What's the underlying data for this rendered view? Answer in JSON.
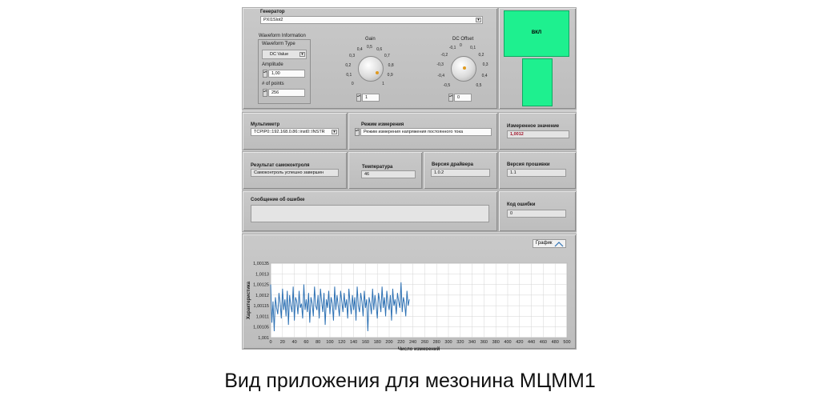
{
  "generator": {
    "title": "Генератор",
    "resource": "PXI1Slot2",
    "waveform_info_title": "Waveform Information",
    "waveform_type_label": "Waveform Type",
    "waveform_type_value": "DC Value",
    "amplitude_label": "Amplitude",
    "amplitude_value": "1,00",
    "points_label": "# of points",
    "points_value": "256",
    "gain": {
      "label": "Gain",
      "ticks": [
        "0",
        "0,1",
        "0,2",
        "0,3",
        "0,4",
        "0,5",
        "0,6",
        "0,7",
        "0,8",
        "0,9",
        "1"
      ],
      "value_text": "1"
    },
    "dc_offset": {
      "label": "DC Offset",
      "ticks": [
        "-0,5",
        "-0,4",
        "-0,3",
        "-0,2",
        "-0,1",
        "0",
        "0,1",
        "0,2",
        "0,3",
        "0,4",
        "0,5"
      ],
      "value_text": "0"
    }
  },
  "power": {
    "label": "ВКЛ",
    "color": "#1ef08f"
  },
  "multimeter": {
    "title": "Мультиметр",
    "resource": "TCPIP0::192.168.0.86::inst0::INSTR",
    "mode_label": "Режим измерения",
    "mode_value": "Режим измерения напряжения постоянного тока",
    "measured_label": "Измеренное значение",
    "measured_value": "1,0012"
  },
  "status": {
    "selftest_label": "Результат самоконтроля",
    "selftest_value": "Самоконтроль успешно завершен",
    "temp_label": "Температура",
    "temp_value": "46",
    "driver_label": "Версия драйвера",
    "driver_value": "1.0.2",
    "firmware_label": "Версия прошивки",
    "firmware_value": "1.1",
    "error_msg_label": "Сообщение об ошибке",
    "error_msg_value": "",
    "error_code_label": "Код ошибки",
    "error_code_value": "0"
  },
  "graph": {
    "legend_label": "График",
    "line_color": "#2f72b4"
  },
  "chart_data": {
    "type": "line",
    "xlabel": "Число измерений",
    "ylabel": "Характеристика",
    "xlim": [
      0,
      500
    ],
    "ylim": [
      1.001,
      1.00135
    ],
    "xticks": [
      "0",
      "20",
      "40",
      "60",
      "80",
      "100",
      "120",
      "140",
      "160",
      "180",
      "200",
      "220",
      "240",
      "260",
      "280",
      "300",
      "320",
      "340",
      "360",
      "380",
      "400",
      "420",
      "440",
      "460",
      "480",
      "500"
    ],
    "yticks": [
      "1,001",
      "1,00105",
      "1,0011",
      "1,00115",
      "1,0012",
      "1,00125",
      "1,0013",
      "1,00135"
    ],
    "grid": true,
    "series": [
      {
        "values": [
          1.00125,
          1.00107,
          1.00117,
          1.00103,
          1.00119,
          1.00114,
          1.00111,
          1.00121,
          1.00116,
          1.00109,
          1.00123,
          1.00113,
          1.00118,
          1.0011,
          1.00122,
          1.00106,
          1.0012,
          1.00115,
          1.00112,
          1.00124,
          1.00108,
          1.00119,
          1.00117,
          1.00111,
          1.00122,
          1.00114,
          1.00116,
          1.00109,
          1.00125,
          1.00113,
          1.00118,
          1.00112,
          1.00121,
          1.00107,
          1.00119,
          1.00116,
          1.0011,
          1.00124,
          1.00115,
          1.00113,
          1.0012,
          1.00109,
          1.00123,
          1.00117,
          1.00112,
          1.00121,
          1.00106,
          1.00118,
          1.00114,
          1.00122,
          1.00111,
          1.00119,
          1.00116,
          1.00108,
          1.00124,
          1.00113,
          1.0012,
          1.00115,
          1.0011,
          1.00122,
          1.00117,
          1.00112,
          1.00121,
          1.00114,
          1.00118,
          1.00109,
          1.00123,
          1.00116,
          1.00111,
          1.0012,
          1.00113,
          1.00119,
          1.00108,
          1.00124,
          1.00115,
          1.00112,
          1.00121,
          1.00117,
          1.0011,
          1.00122,
          1.00114,
          1.00118,
          1.00103,
          1.00119,
          1.00116,
          1.00111,
          1.00123,
          1.00113,
          1.0012,
          1.00115,
          1.00109,
          1.00121,
          1.00117,
          1.00112,
          1.00124,
          1.00114,
          1.00119,
          1.0011,
          1.00122,
          1.00116,
          1.00113,
          1.0012,
          1.00108,
          1.00123,
          1.00115,
          1.00118,
          1.00111,
          1.00121,
          1.00117,
          1.00114,
          1.00126,
          1.00112,
          1.00119,
          1.00116,
          1.0011,
          1.00122,
          1.00115,
          1.00118
        ]
      }
    ]
  }
}
